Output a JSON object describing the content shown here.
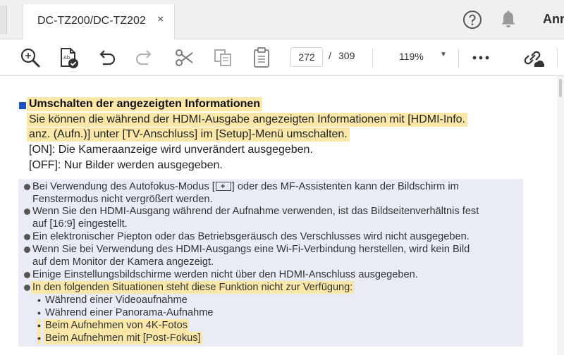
{
  "tabs": {
    "active_title": "DC-TZ200/DC-TZ202",
    "close_glyph": "×"
  },
  "header": {
    "user_name": "Ann"
  },
  "toolbar": {
    "page_current": "272",
    "page_separator": "/",
    "page_total": "309",
    "zoom": "119%"
  },
  "document": {
    "heading": "Umschalten der angezeigten Informationen",
    "lead": [
      "Sie können die während der HDMI-Ausgabe angezeigten Informationen mit [HDMI-Info.",
      "anz. (Aufn.)] unter [TV-Anschluss] im [Setup]-Menü umschalten.",
      "[ON]: Die Kameraanzeige wird unverändert ausgegeben.",
      "[OFF]: Nur Bilder werden ausgegeben."
    ],
    "notes": {
      "n1a": "Bei Verwendung des Autofokus-Modus [",
      "n1b": "] oder des MF-Assistenten kann der Bildschirm im",
      "n1c": "Fenstermodus nicht vergrößert werden.",
      "n2a": "Wenn Sie den HDMI-Ausgang während der Aufnahme verwenden, ist das Bildseitenverhältnis fest",
      "n2b": "auf [16:9] eingestellt.",
      "n3": "Ein elektronischer Piepton oder das Betriebsgeräusch des Verschlusses wird nicht ausgegeben.",
      "n4a": "Wenn Sie bei Verwendung des HDMI-Ausgangs eine Wi-Fi-Verbindung herstellen, wird kein Bild",
      "n4b": "auf dem Monitor der Kamera angezeigt.",
      "n5": "Einige Einstellungsbildschirme werden nicht über den HDMI-Anschluss ausgegeben.",
      "n6": "In den folgenden Situationen steht diese Funktion nicht zur Verfügung:",
      "sub": [
        "Während einer Videoaufnahme",
        "Während einer Panorama-Aufnahme",
        "Beim Aufnehmen von 4K-Fotos",
        "Beim Aufnehmen mit [Post-Fokus]"
      ],
      "sub_bullet": "•"
    }
  },
  "colors": {
    "highlight": "#fbe7a8",
    "note_background": "#e9ecf6",
    "heading_square": "#1f4fc4"
  },
  "icons": [
    "search-icon",
    "read-aloud-icon",
    "undo-icon",
    "redo-icon",
    "cut-icon",
    "copy-icon",
    "paste-icon",
    "more-icon",
    "share-link-icon",
    "help-icon",
    "bell-icon",
    "autofocus-frame-icon"
  ]
}
